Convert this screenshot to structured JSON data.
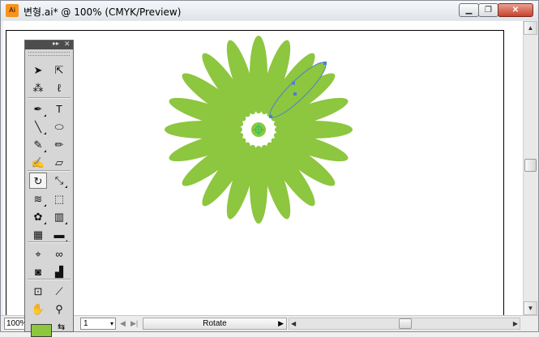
{
  "window": {
    "title": "변형.ai* @ 100% (CMYK/Preview)",
    "app_icon_label": "Ai",
    "minimize_glyph": "▁",
    "restore_glyph": "❐",
    "close_glyph": "✕"
  },
  "colors": {
    "flower_fill": "#8dc63f",
    "selection": "#4f7fd0",
    "center_point": "#22c55e"
  },
  "tool_panel": {
    "collapse_glyph": "▸▸",
    "close_glyph": "✕",
    "tools": [
      {
        "name": "selection-tool-icon",
        "glyph": "➤"
      },
      {
        "name": "direct-selection-tool-icon",
        "glyph": "⇱"
      },
      {
        "name": "magic-wand-tool-icon",
        "glyph": "⁂"
      },
      {
        "name": "lasso-tool-icon",
        "glyph": "ℓ"
      },
      {
        "name": "pen-tool-icon",
        "glyph": "✒"
      },
      {
        "name": "type-tool-icon",
        "glyph": "T"
      },
      {
        "name": "line-tool-icon",
        "glyph": "╲"
      },
      {
        "name": "ellipse-tool-icon",
        "glyph": "⬭"
      },
      {
        "name": "paintbrush-tool-icon",
        "glyph": "✎"
      },
      {
        "name": "pencil-tool-icon",
        "glyph": "✏"
      },
      {
        "name": "blob-brush-tool-icon",
        "glyph": "✍"
      },
      {
        "name": "eraser-tool-icon",
        "glyph": "▱"
      },
      {
        "name": "rotate-tool-icon",
        "glyph": "↻"
      },
      {
        "name": "scale-tool-icon",
        "glyph": "⤡"
      },
      {
        "name": "warp-tool-icon",
        "glyph": "≋"
      },
      {
        "name": "free-transform-tool-icon",
        "glyph": "⬚"
      },
      {
        "name": "symbol-sprayer-tool-icon",
        "glyph": "✿"
      },
      {
        "name": "column-graph-tool-icon",
        "glyph": "▥"
      },
      {
        "name": "mesh-tool-icon",
        "glyph": "▦"
      },
      {
        "name": "gradient-tool-icon",
        "glyph": "▬"
      },
      {
        "name": "eyedropper-tool-icon",
        "glyph": "⌖"
      },
      {
        "name": "blend-tool-icon",
        "glyph": "∞"
      },
      {
        "name": "symbol-tool-icon",
        "glyph": "◙"
      },
      {
        "name": "graph-tool-icon",
        "glyph": "▟"
      },
      {
        "name": "artboard-tool-icon",
        "glyph": "⊡"
      },
      {
        "name": "slice-tool-icon",
        "glyph": "⟋"
      },
      {
        "name": "hand-tool-icon",
        "glyph": "✋"
      },
      {
        "name": "zoom-tool-icon",
        "glyph": "⚲"
      }
    ],
    "swap_glyph": "⇆"
  },
  "status": {
    "zoom": "100%",
    "page": "1",
    "dropdown_glyph": "▾",
    "first_glyph": "|◀",
    "prev_glyph": "◀",
    "next_glyph": "▶",
    "last_glyph": "▶|",
    "current_tool": "Rotate",
    "play_glyph": "▶"
  },
  "scroll": {
    "up": "▲",
    "down": "▼",
    "left": "◀",
    "right": "▶"
  }
}
